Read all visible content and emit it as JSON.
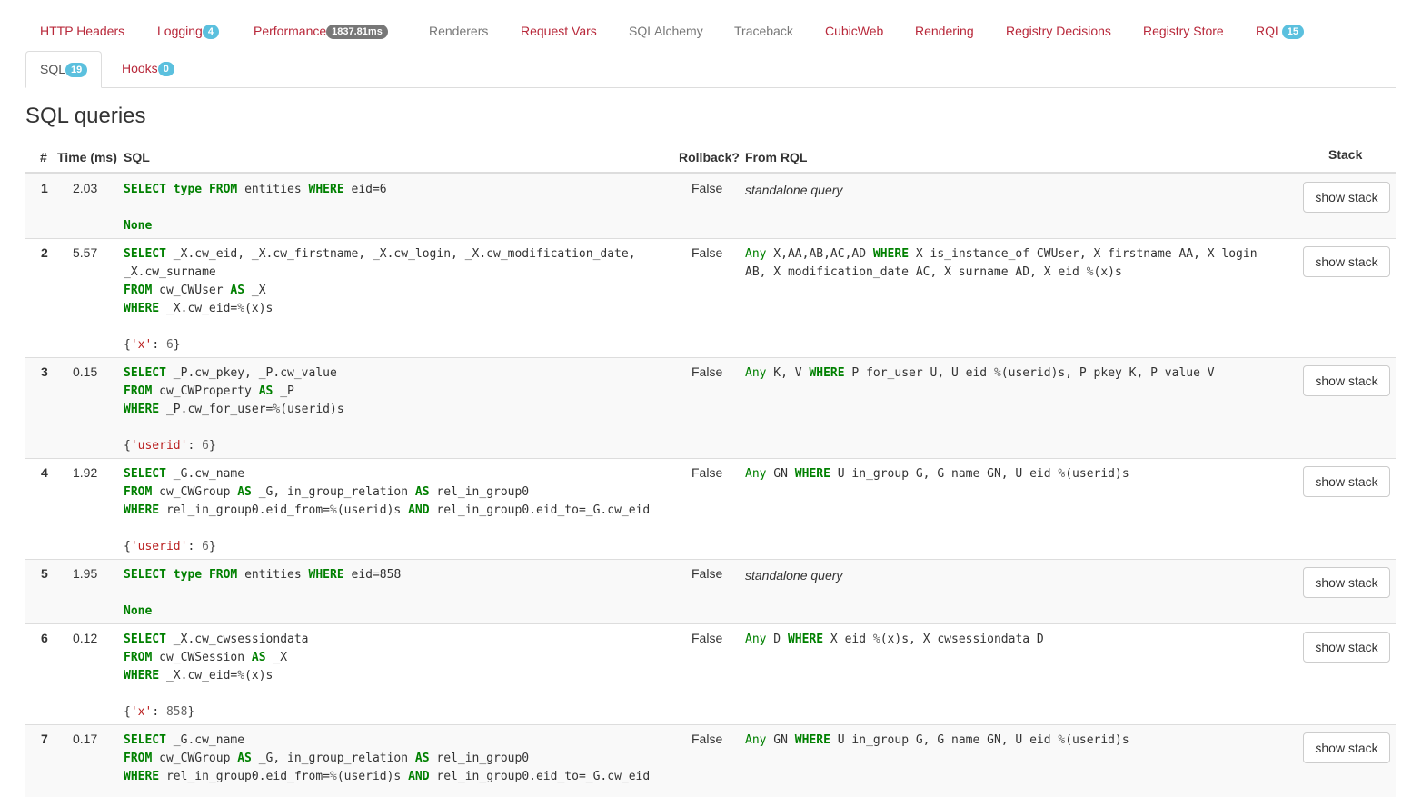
{
  "tabs": {
    "row1": [
      {
        "label": "HTTP Headers",
        "badge": ""
      },
      {
        "label": "Logging",
        "badge": "4"
      },
      {
        "label": "Performance",
        "badge": "1837.81ms"
      },
      {
        "label": "Renderers",
        "badge": ""
      },
      {
        "label": "Request Vars",
        "badge": ""
      },
      {
        "label": "SQLAlchemy",
        "badge": ""
      },
      {
        "label": "Traceback",
        "badge": ""
      },
      {
        "label": "CubicWeb",
        "badge": ""
      },
      {
        "label": "Rendering",
        "badge": ""
      },
      {
        "label": "Registry Decisions",
        "badge": ""
      },
      {
        "label": "Registry Store",
        "badge": ""
      },
      {
        "label": "RQL",
        "badge": "15"
      }
    ],
    "row2": [
      {
        "label": "SQL",
        "badge": "19"
      },
      {
        "label": "Hooks",
        "badge": "0"
      }
    ]
  },
  "page_title": "SQL queries",
  "table": {
    "headers": {
      "num": "#",
      "time": "Time (ms)",
      "sql": "SQL",
      "rollback": "Rollback?",
      "rql": "From RQL",
      "stack": "Stack"
    },
    "stack_button_label": "show stack",
    "rows": [
      {
        "num": "1",
        "time": "2.03",
        "rollback": "False",
        "rql": "standalone query",
        "params": "None"
      },
      {
        "num": "2",
        "time": "5.57",
        "rollback": "False",
        "rql": "Any X,AA,AB,AC,AD WHERE X is_instance_of CWUser, X firstname AA, X login AB, X modification_date AC, X surname AD, X eid %(x)s",
        "params": "{'x': 6}"
      },
      {
        "num": "3",
        "time": "0.15",
        "rollback": "False",
        "rql": "Any K, V WHERE P for_user U, U eid %(userid)s, P pkey K, P value V",
        "params": "{'userid': 6}"
      },
      {
        "num": "4",
        "time": "1.92",
        "rollback": "False",
        "rql": "Any GN WHERE U in_group G, G name GN, U eid %(userid)s",
        "params": "{'userid': 6}"
      },
      {
        "num": "5",
        "time": "1.95",
        "rollback": "False",
        "rql": "standalone query",
        "params": "None"
      },
      {
        "num": "6",
        "time": "0.12",
        "rollback": "False",
        "rql": "Any D WHERE X eid %(x)s, X cwsessiondata D",
        "params": "{'x': 858}"
      },
      {
        "num": "7",
        "time": "0.17",
        "rollback": "False",
        "rql": "Any GN WHERE U in_group G, G name GN, U eid %(userid)s",
        "params": ""
      }
    ],
    "sql": [
      [
        "SELECT type FROM entities WHERE eid=6"
      ],
      [
        "SELECT _X.cw_eid, _X.cw_firstname, _X.cw_login, _X.cw_modification_date,",
        "_X.cw_surname",
        "FROM cw_CWUser AS _X",
        "WHERE _X.cw_eid=%(x)s"
      ],
      [
        "SELECT _P.cw_pkey, _P.cw_value",
        "FROM cw_CWProperty AS _P",
        "WHERE _P.cw_for_user=%(userid)s"
      ],
      [
        "SELECT _G.cw_name",
        "FROM cw_CWGroup AS _G, in_group_relation AS rel_in_group0",
        "WHERE rel_in_group0.eid_from=%(userid)s AND rel_in_group0.eid_to=_G.cw_eid"
      ],
      [
        "SELECT type FROM entities WHERE eid=858"
      ],
      [
        "SELECT _X.cw_cwsessiondata",
        "FROM cw_CWSession AS _X",
        "WHERE _X.cw_eid=%(x)s"
      ],
      [
        "SELECT _G.cw_name",
        "FROM cw_CWGroup AS _G, in_group_relation AS rel_in_group0",
        "WHERE rel_in_group0.eid_from=%(userid)s AND rel_in_group0.eid_to=_G.cw_eid"
      ]
    ]
  }
}
